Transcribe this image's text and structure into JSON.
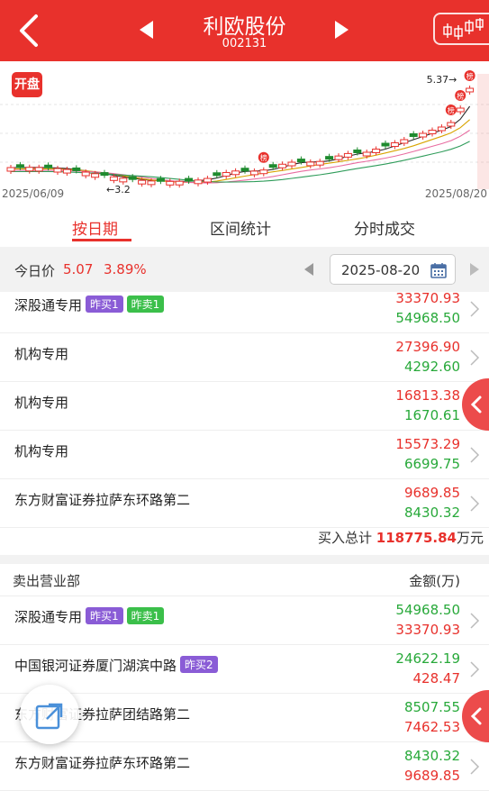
{
  "header": {
    "title": "利欧股份",
    "code": "002131"
  },
  "chart": {
    "kaipan_label": "开盘",
    "date_start": "2025/06/09",
    "date_end": "2025/08/20",
    "high_label": "5.37",
    "low_label": "3.2",
    "limit_up_marker": "榜"
  },
  "tabs": [
    "按日期",
    "区间统计",
    "分时成交"
  ],
  "price": {
    "label": "今日价",
    "value": "5.07",
    "change": "3.89%",
    "date": "2025-08-20"
  },
  "buy_rows": [
    {
      "name": "深股通专用",
      "badges": [
        {
          "text": "昨买1",
          "color": "purple"
        },
        {
          "text": "昨卖1",
          "color": "green"
        }
      ],
      "buy": "33370.93",
      "sell": "54968.50"
    },
    {
      "name": "机构专用",
      "badges": [],
      "buy": "27396.90",
      "sell": "4292.60"
    },
    {
      "name": "机构专用",
      "badges": [],
      "buy": "16813.38",
      "sell": "1670.61"
    },
    {
      "name": "机构专用",
      "badges": [],
      "buy": "15573.29",
      "sell": "6699.75"
    },
    {
      "name": "东方财富证券拉萨东环路第二",
      "badges": [],
      "buy": "9689.85",
      "sell": "8430.32"
    }
  ],
  "buy_total": {
    "label": "买入总计",
    "value": "118775.84",
    "unit": "万元"
  },
  "sell_header": {
    "left": "卖出营业部",
    "right": "金额(万)"
  },
  "sell_rows": [
    {
      "name": "深股通专用",
      "badges": [
        {
          "text": "昨买1",
          "color": "purple"
        },
        {
          "text": "昨卖1",
          "color": "green"
        }
      ],
      "sell": "54968.50",
      "buy": "33370.93"
    },
    {
      "name": "中国银河证券厦门湖滨中路",
      "badges": [
        {
          "text": "昨买2",
          "color": "purple"
        }
      ],
      "sell": "24622.19",
      "buy": "428.47"
    },
    {
      "name": "东方财富证券拉萨团结路第二",
      "badges": [],
      "sell": "8507.55",
      "buy": "7462.53"
    },
    {
      "name": "东方财富证券拉萨东环路第二",
      "badges": [],
      "sell": "8430.32",
      "buy": "9689.85"
    }
  ]
}
